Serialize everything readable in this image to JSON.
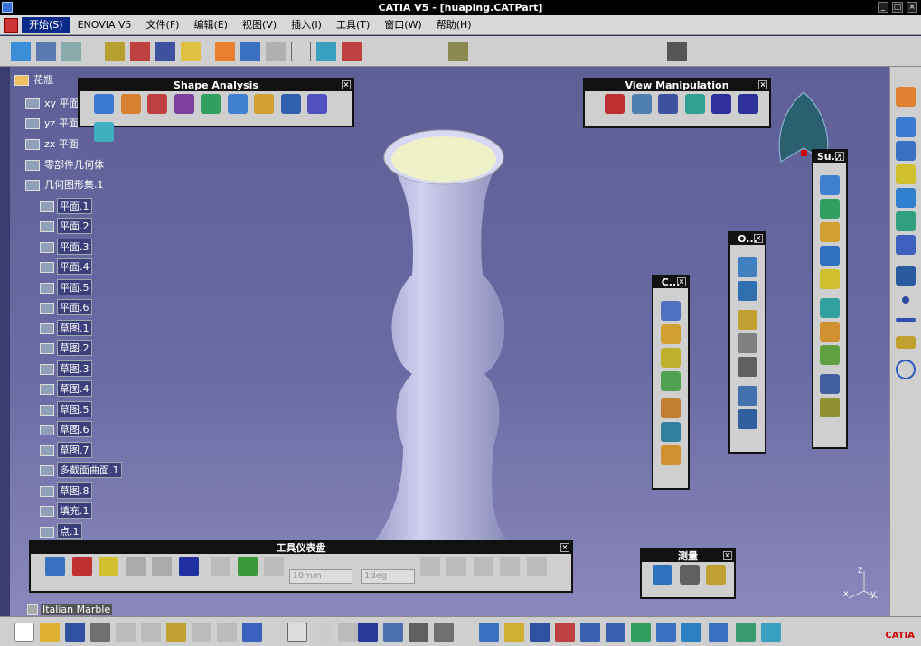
{
  "window": {
    "title": "CATIA V5 - [huaping.CATPart]"
  },
  "menu": [
    "开始(S)",
    "ENOVIA V5",
    "文件(F)",
    "编辑(E)",
    "视图(V)",
    "插入(I)",
    "工具(T)",
    "窗口(W)",
    "帮助(H)"
  ],
  "tree": {
    "root": "花瓶",
    "items": [
      {
        "label": "xy 平面",
        "selected": false
      },
      {
        "label": "yz 平面",
        "selected": false
      },
      {
        "label": "zx 平面",
        "selected": false
      },
      {
        "label": "零部件几何体",
        "selected": false
      },
      {
        "label": "几何图形集.1",
        "selected": false
      },
      {
        "label": "平面.1",
        "selected": true
      },
      {
        "label": "平面.2",
        "selected": true
      },
      {
        "label": "平面.3",
        "selected": true
      },
      {
        "label": "平面.4",
        "selected": true
      },
      {
        "label": "平面.5",
        "selected": true
      },
      {
        "label": "平面.6",
        "selected": true
      },
      {
        "label": "草图.1",
        "selected": true
      },
      {
        "label": "草图.2",
        "selected": true
      },
      {
        "label": "草图.3",
        "selected": true
      },
      {
        "label": "草图.4",
        "selected": true
      },
      {
        "label": "草图.5",
        "selected": true
      },
      {
        "label": "草图.6",
        "selected": true
      },
      {
        "label": "草图.7",
        "selected": true
      },
      {
        "label": "多截面曲面.1",
        "selected": true
      },
      {
        "label": "草图.8",
        "selected": true
      },
      {
        "label": "填充.1",
        "selected": true
      },
      {
        "label": "点.1",
        "selected": true
      }
    ],
    "material": "Italian Marble"
  },
  "panels": {
    "shape_analysis": "Shape Analysis",
    "view_manipulation": "View Manipulation",
    "su": "Su...",
    "o": "O...",
    "c": "C...",
    "dashboard": "工具仪表盘",
    "measure": "测量"
  },
  "dashboard": {
    "length_field": "10mm",
    "angle_field": "1deg"
  },
  "axis": {
    "x": "x",
    "y": "y",
    "z": "z"
  },
  "brand": "CATIA",
  "colors": {
    "accent": "#0a2a8a",
    "vase": "#b8b8e0",
    "background": "#6a6aa4"
  }
}
